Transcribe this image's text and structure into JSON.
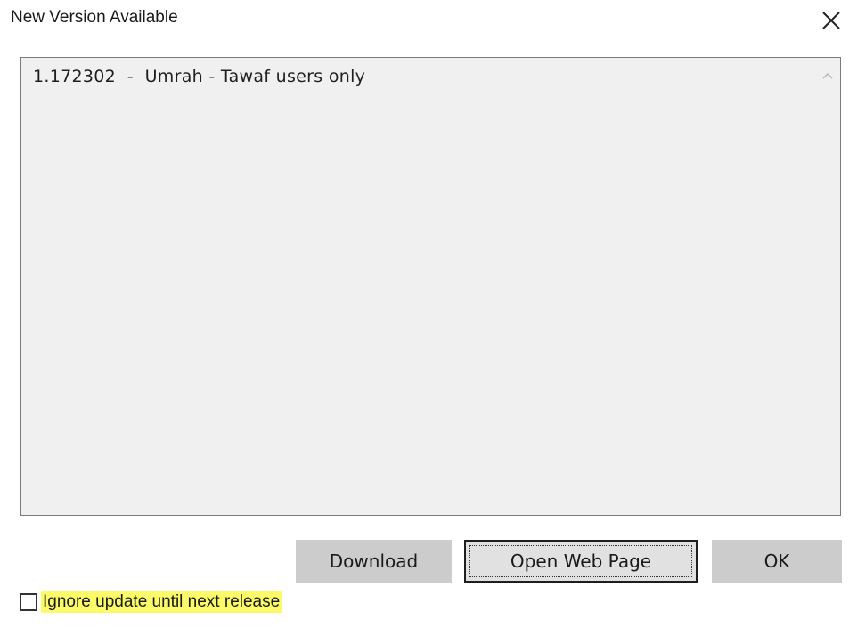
{
  "window": {
    "title": "New Version Available",
    "close_icon": "close-icon"
  },
  "release_notes": {
    "lines": [
      "1.172302  -  Umrah - Tawaf users only"
    ],
    "scroll_icon": "chevron-up-icon"
  },
  "buttons": {
    "download": "Download",
    "open_web_page": "Open Web Page",
    "ok": "OK"
  },
  "ignore_option": {
    "label": "Ignore update until next release",
    "checked": false,
    "highlight_color": "#fbfb6a"
  }
}
